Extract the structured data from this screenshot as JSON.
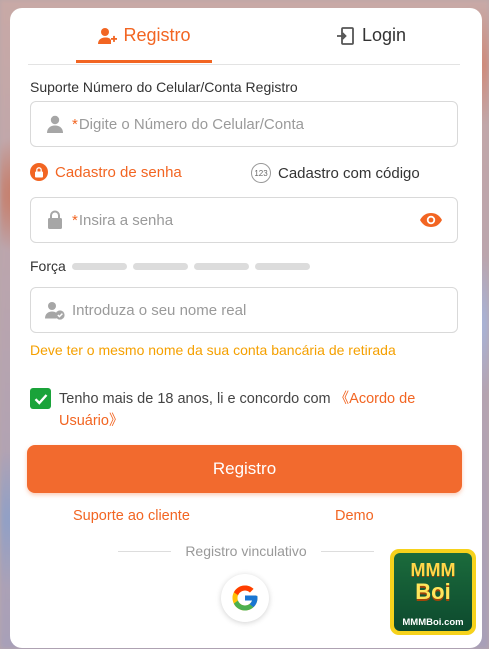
{
  "tabs": {
    "register_label": "Registro",
    "login_label": "Login"
  },
  "phone": {
    "label": "Suporte Número do Celular/Conta Registro",
    "required_mark": "*",
    "placeholder": "Digite o Número do Celular/Conta"
  },
  "modes": {
    "password_label": "Cadastro de senha",
    "code_label": "Cadastro com código",
    "code_icon_text": "123"
  },
  "password": {
    "required_mark": "*",
    "placeholder": "Insira a senha"
  },
  "strength": {
    "label": "Força"
  },
  "realname": {
    "placeholder": "Introduza o seu nome real",
    "hint": "Deve ter o mesmo nome da sua conta bancária de retirada"
  },
  "agreement": {
    "checked": true,
    "text": "Tenho mais de 18 anos, li e concordo com ",
    "link": "《Acordo de Usuário》"
  },
  "submit_label": "Registro",
  "links": {
    "support": "Suporte ao cliente",
    "demo": "Demo"
  },
  "divider_label": "Registro vinculativo",
  "badge": {
    "line1": "MMM",
    "line2": "Boi",
    "url": "MMMBoi.com"
  },
  "colors": {
    "accent": "#f26522",
    "hint": "#f5a000",
    "checkbox": "#1aa33a"
  }
}
